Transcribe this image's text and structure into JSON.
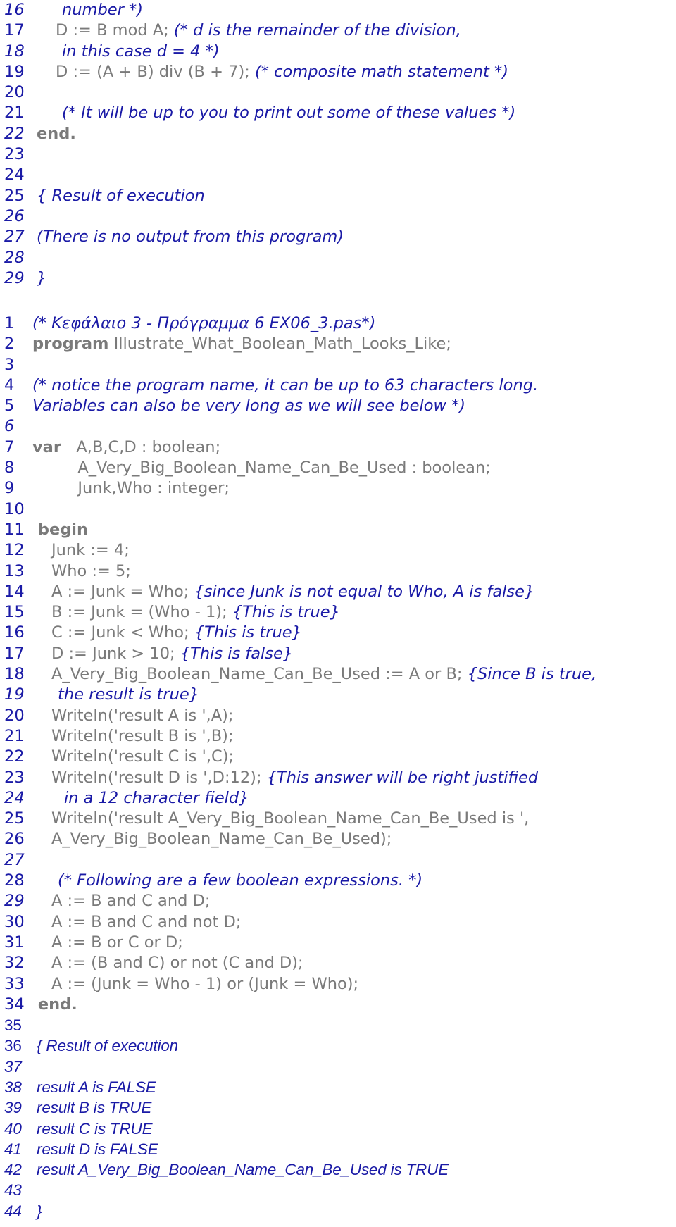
{
  "colors": {
    "line_number": "#1a1aa6",
    "comment": "#1a1aa6",
    "code": "#7a7a7a"
  },
  "listing_1": {
    "lines": [
      {
        "n": "16",
        "num_italic": true,
        "indent": 4,
        "segs": [
          {
            "t": "cm",
            "v": "number *)"
          }
        ]
      },
      {
        "n": "17",
        "num_italic": false,
        "indent": 3,
        "segs": [
          {
            "t": "code",
            "v": "D := B mod A; "
          },
          {
            "t": "cm",
            "v": "(* d is the remainder of the division,"
          }
        ]
      },
      {
        "n": "18",
        "num_italic": true,
        "indent": 4,
        "segs": [
          {
            "t": "cm",
            "v": "in this case d = 4 *)"
          }
        ]
      },
      {
        "n": "19",
        "num_italic": false,
        "indent": 3,
        "segs": [
          {
            "t": "code",
            "v": "D := (A + B) div (B + 7); "
          },
          {
            "t": "cm",
            "v": "(* composite math statement *)"
          }
        ]
      },
      {
        "n": "20",
        "num_italic": false,
        "indent": 0,
        "segs": []
      },
      {
        "n": "21",
        "num_italic": false,
        "indent": 4,
        "segs": [
          {
            "t": "cm",
            "v": "(* It will be up to you to print out some of these values *)"
          }
        ]
      },
      {
        "n": "22",
        "num_italic": true,
        "indent": 0,
        "segs": [
          {
            "t": "kw",
            "v": "end."
          }
        ]
      },
      {
        "n": "23",
        "num_italic": false,
        "indent": 0,
        "segs": []
      },
      {
        "n": "24",
        "num_italic": false,
        "indent": 0,
        "segs": []
      },
      {
        "n": "25",
        "num_italic": false,
        "indent": 0,
        "segs": [
          {
            "t": "cm",
            "v": "{ Result of execution"
          }
        ]
      },
      {
        "n": "26",
        "num_italic": true,
        "indent": 0,
        "segs": []
      },
      {
        "n": "27",
        "num_italic": true,
        "indent": 0,
        "segs": [
          {
            "t": "cm",
            "v": "(There is no output from this program)"
          }
        ]
      },
      {
        "n": "28",
        "num_italic": true,
        "indent": 0,
        "segs": []
      },
      {
        "n": "29",
        "num_italic": true,
        "indent": 0,
        "segs": [
          {
            "t": "cm",
            "v": "}"
          }
        ]
      }
    ]
  },
  "listing_2": {
    "lines": [
      {
        "n": "1",
        "num_italic": false,
        "indent": 0,
        "segs": [
          {
            "t": "cm",
            "v": "(* Κεφάλαιο 3 - Πρόγραμμα 6 EX06_3.pas*)"
          }
        ]
      },
      {
        "n": "2",
        "num_italic": false,
        "indent": 0,
        "segs": [
          {
            "t": "kw",
            "v": "program"
          },
          {
            "t": "code",
            "v": " Illustrate_What_Boolean_Math_Looks_Like;"
          }
        ]
      },
      {
        "n": "3",
        "num_italic": false,
        "indent": 0,
        "segs": []
      },
      {
        "n": "4",
        "num_italic": false,
        "indent": 0,
        "segs": [
          {
            "t": "cm",
            "v": "(* notice the program name, it can be up to 63 characters long."
          }
        ]
      },
      {
        "n": "5",
        "num_italic": false,
        "indent": 0,
        "segs": [
          {
            "t": "cm",
            "v": "Variables can also be very long as we will see below *)"
          }
        ]
      },
      {
        "n": "6",
        "num_italic": true,
        "indent": 0,
        "segs": []
      },
      {
        "n": "7",
        "num_italic": false,
        "indent": 0,
        "segs": [
          {
            "t": "kw",
            "v": "var"
          },
          {
            "t": "code",
            "v": "   A,B,C,D : boolean;"
          }
        ]
      },
      {
        "n": "8",
        "num_italic": false,
        "indent": 0,
        "segs": [
          {
            "t": "code",
            "v": "         A_Very_Big_Boolean_Name_Can_Be_Used : boolean;"
          }
        ]
      },
      {
        "n": "9",
        "num_italic": false,
        "indent": 0,
        "segs": [
          {
            "t": "code",
            "v": "         Junk,Who : integer;"
          }
        ]
      },
      {
        "n": "10",
        "num_italic": false,
        "indent": 0,
        "segs": []
      },
      {
        "n": "11",
        "num_italic": false,
        "indent": 0,
        "segs": [
          {
            "t": "kw",
            "v": " begin"
          }
        ]
      },
      {
        "n": "12",
        "num_italic": false,
        "indent": 3,
        "segs": [
          {
            "t": "code",
            "v": "Junk := 4;"
          }
        ]
      },
      {
        "n": "13",
        "num_italic": false,
        "indent": 3,
        "segs": [
          {
            "t": "code",
            "v": "Who := 5;"
          }
        ]
      },
      {
        "n": "14",
        "num_italic": false,
        "indent": 3,
        "segs": [
          {
            "t": "code",
            "v": "A := Junk = Who; "
          },
          {
            "t": "cm",
            "v": "{since Junk is not equal to Who, A is false}"
          }
        ]
      },
      {
        "n": "15",
        "num_italic": false,
        "indent": 3,
        "segs": [
          {
            "t": "code",
            "v": "B := Junk = (Who - 1); "
          },
          {
            "t": "cm",
            "v": "{This is true}"
          }
        ]
      },
      {
        "n": "16",
        "num_italic": false,
        "indent": 3,
        "segs": [
          {
            "t": "code",
            "v": "C := Junk < Who; "
          },
          {
            "t": "cm",
            "v": "{This is true}"
          }
        ]
      },
      {
        "n": "17",
        "num_italic": false,
        "indent": 3,
        "segs": [
          {
            "t": "code",
            "v": "D := Junk > 10; "
          },
          {
            "t": "cm",
            "v": "{This is false}"
          }
        ]
      },
      {
        "n": "18",
        "num_italic": false,
        "indent": 3,
        "segs": [
          {
            "t": "code",
            "v": "A_Very_Big_Boolean_Name_Can_Be_Used := A or B; "
          },
          {
            "t": "cm",
            "v": "{Since B is true,"
          }
        ]
      },
      {
        "n": "19",
        "num_italic": true,
        "indent": 4,
        "segs": [
          {
            "t": "cm",
            "v": "the result is true}"
          }
        ]
      },
      {
        "n": "20",
        "num_italic": false,
        "indent": 3,
        "segs": [
          {
            "t": "code",
            "v": "Writeln('result A is ',A);"
          }
        ]
      },
      {
        "n": "21",
        "num_italic": false,
        "indent": 3,
        "segs": [
          {
            "t": "code",
            "v": "Writeln('result B is ',B);"
          }
        ]
      },
      {
        "n": "22",
        "num_italic": false,
        "indent": 3,
        "segs": [
          {
            "t": "code",
            "v": "Writeln('result C is ',C);"
          }
        ]
      },
      {
        "n": "23",
        "num_italic": false,
        "indent": 3,
        "segs": [
          {
            "t": "code",
            "v": "Writeln('result D is ',D:12); "
          },
          {
            "t": "cm",
            "v": "{This answer will be right justified"
          }
        ]
      },
      {
        "n": "24",
        "num_italic": true,
        "indent": 5,
        "segs": [
          {
            "t": "cm",
            "v": "in a 12 character field}"
          }
        ]
      },
      {
        "n": "25",
        "num_italic": false,
        "indent": 3,
        "segs": [
          {
            "t": "code",
            "v": "Writeln('result A_Very_Big_Boolean_Name_Can_Be_Used is ',"
          }
        ]
      },
      {
        "n": "26",
        "num_italic": false,
        "indent": 3,
        "segs": [
          {
            "t": "code",
            "v": "A_Very_Big_Boolean_Name_Can_Be_Used);"
          }
        ]
      },
      {
        "n": "27",
        "num_italic": true,
        "indent": 0,
        "segs": []
      },
      {
        "n": "28",
        "num_italic": false,
        "indent": 4,
        "segs": [
          {
            "t": "cm",
            "v": "(* Following are a few boolean expressions. *)"
          }
        ]
      },
      {
        "n": "29",
        "num_italic": true,
        "indent": 3,
        "segs": [
          {
            "t": "code",
            "v": "A := B and C and D;"
          }
        ]
      },
      {
        "n": "30",
        "num_italic": false,
        "indent": 3,
        "segs": [
          {
            "t": "code",
            "v": "A := B and C and not D;"
          }
        ]
      },
      {
        "n": "31",
        "num_italic": false,
        "indent": 3,
        "segs": [
          {
            "t": "code",
            "v": "A := B or C or D;"
          }
        ]
      },
      {
        "n": "32",
        "num_italic": false,
        "indent": 3,
        "segs": [
          {
            "t": "code",
            "v": "A := (B and C) or not (C and D);"
          }
        ]
      },
      {
        "n": "33",
        "num_italic": false,
        "indent": 3,
        "segs": [
          {
            "t": "code",
            "v": "A := (Junk = Who - 1) or (Junk = Who);"
          }
        ]
      },
      {
        "n": "34",
        "num_italic": false,
        "indent": 0,
        "segs": [
          {
            "t": "kw",
            "v": " end."
          }
        ]
      },
      {
        "n": "35",
        "num_italic": false,
        "indent": 0,
        "segs": [],
        "narrow": true
      },
      {
        "n": "36",
        "num_italic": false,
        "indent": 0,
        "segs": [
          {
            "t": "cm",
            "v": " { Result of execution"
          }
        ],
        "narrow": true
      },
      {
        "n": "37",
        "num_italic": true,
        "indent": 0,
        "segs": [],
        "narrow": true
      },
      {
        "n": "38",
        "num_italic": true,
        "indent": 0,
        "segs": [
          {
            "t": "cm",
            "v": " result A is FALSE"
          }
        ],
        "narrow": true
      },
      {
        "n": "39",
        "num_italic": true,
        "indent": 0,
        "segs": [
          {
            "t": "cm",
            "v": " result B is TRUE"
          }
        ],
        "narrow": true
      },
      {
        "n": "40",
        "num_italic": true,
        "indent": 0,
        "segs": [
          {
            "t": "cm",
            "v": " result C is TRUE"
          }
        ],
        "narrow": true
      },
      {
        "n": "41",
        "num_italic": true,
        "indent": 0,
        "segs": [
          {
            "t": "cm",
            "v": " result D is FALSE"
          }
        ],
        "narrow": true
      },
      {
        "n": "42",
        "num_italic": true,
        "indent": 0,
        "segs": [
          {
            "t": "cm",
            "v": " result A_Very_Big_Boolean_Name_Can_Be_Used is TRUE"
          }
        ],
        "narrow": true
      },
      {
        "n": "43",
        "num_italic": true,
        "indent": 0,
        "segs": [],
        "narrow": true
      },
      {
        "n": "44",
        "num_italic": true,
        "indent": 0,
        "segs": [
          {
            "t": "cm",
            "v": " }"
          }
        ],
        "narrow": true
      }
    ]
  }
}
